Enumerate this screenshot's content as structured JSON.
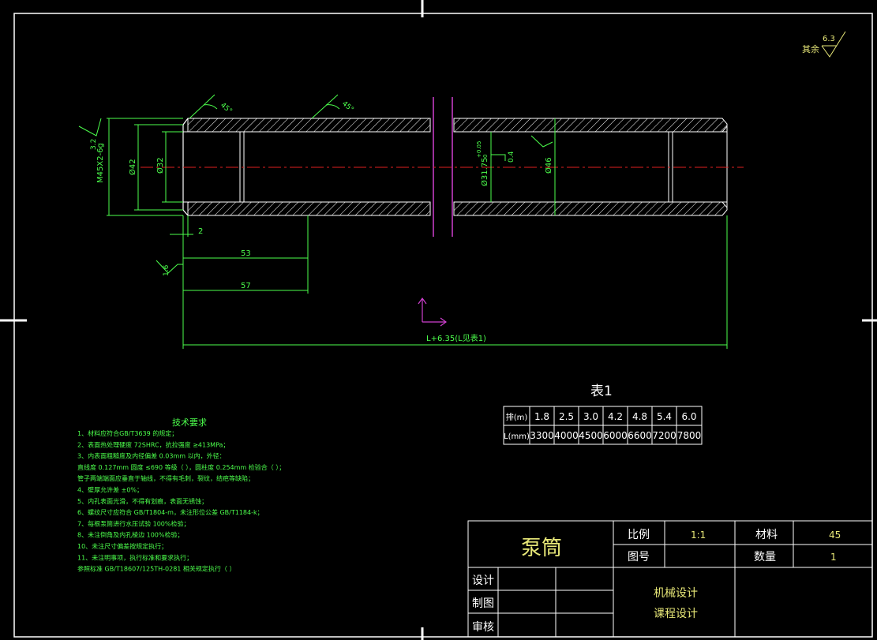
{
  "drawing": {
    "roughness_top": {
      "other_label": "其余",
      "value": "6.3"
    },
    "chamfer_label": "45°",
    "dims": {
      "thread": "M45X2-6g",
      "thread_rough": "3.2",
      "d42": "Ø42",
      "d32": "Ø32",
      "d31": "Ø31.75",
      "d31_tol_upper": "+0.05",
      "d31_tol_lower": "0",
      "d31_rough": "0.4",
      "d46": "Ø46",
      "len2": "2",
      "len53": "53",
      "len57": "57",
      "rough16": "1.6",
      "total": "L+6.35(L见表1)"
    }
  },
  "table": {
    "caption": "表1",
    "header": [
      "排(m)",
      "1.8",
      "2.5",
      "3.0",
      "4.2",
      "4.8",
      "5.4",
      "6.0"
    ],
    "row": [
      "L(mm)",
      "3300",
      "4000",
      "4500",
      "6000",
      "6600",
      "7200",
      "7800"
    ]
  },
  "notes": {
    "title": "技术要求",
    "lines": [
      "1、材料应符合GB/T3639 的规定；",
      "2、表面热处理硬度 72SHRC，抗拉强度 ≥413MPa；",
      "3、内表面粗糙度及内径偏差 0.03mm 以内，外径：",
      "   直线度 0.127mm 圆度 ≤690 等级（   ），圆柱度 0.254mm 检验合（   ）；",
      "   管子两端端面应垂直于轴线，不得有毛刺，裂纹，结疤等缺陷；",
      "4、壁厚允许差 ±0%；",
      "5、内孔表面光滑，不得有划痕，表面无锈蚀；",
      "6、螺纹尺寸应符合 GB/T1804-m，未注形位公差 GB/T1184-k；",
      "7、每根泵筒进行水压试验 100%检验；",
      "8、未注倒角及内孔棱边 100%检验；",
      "10、未注尺寸偏差按规定执行；",
      "11、未注明事项，执行标准和要求执行；",
      "    参照标准 GB/T18607/125TH-0281 相关规定执行（  ）"
    ]
  },
  "title_block": {
    "part_name": "泵筒",
    "scale_label": "比例",
    "scale_value": "1:1",
    "material_label": "材料",
    "material_value": "45",
    "drawing_no_label": "图号",
    "drawing_no_value": "",
    "quantity_label": "数量",
    "quantity_value": "1",
    "design_label": "设计",
    "draft_label": "制图",
    "review_label": "审核",
    "course_line1": "机械设计",
    "course_line2": "课程设计"
  }
}
